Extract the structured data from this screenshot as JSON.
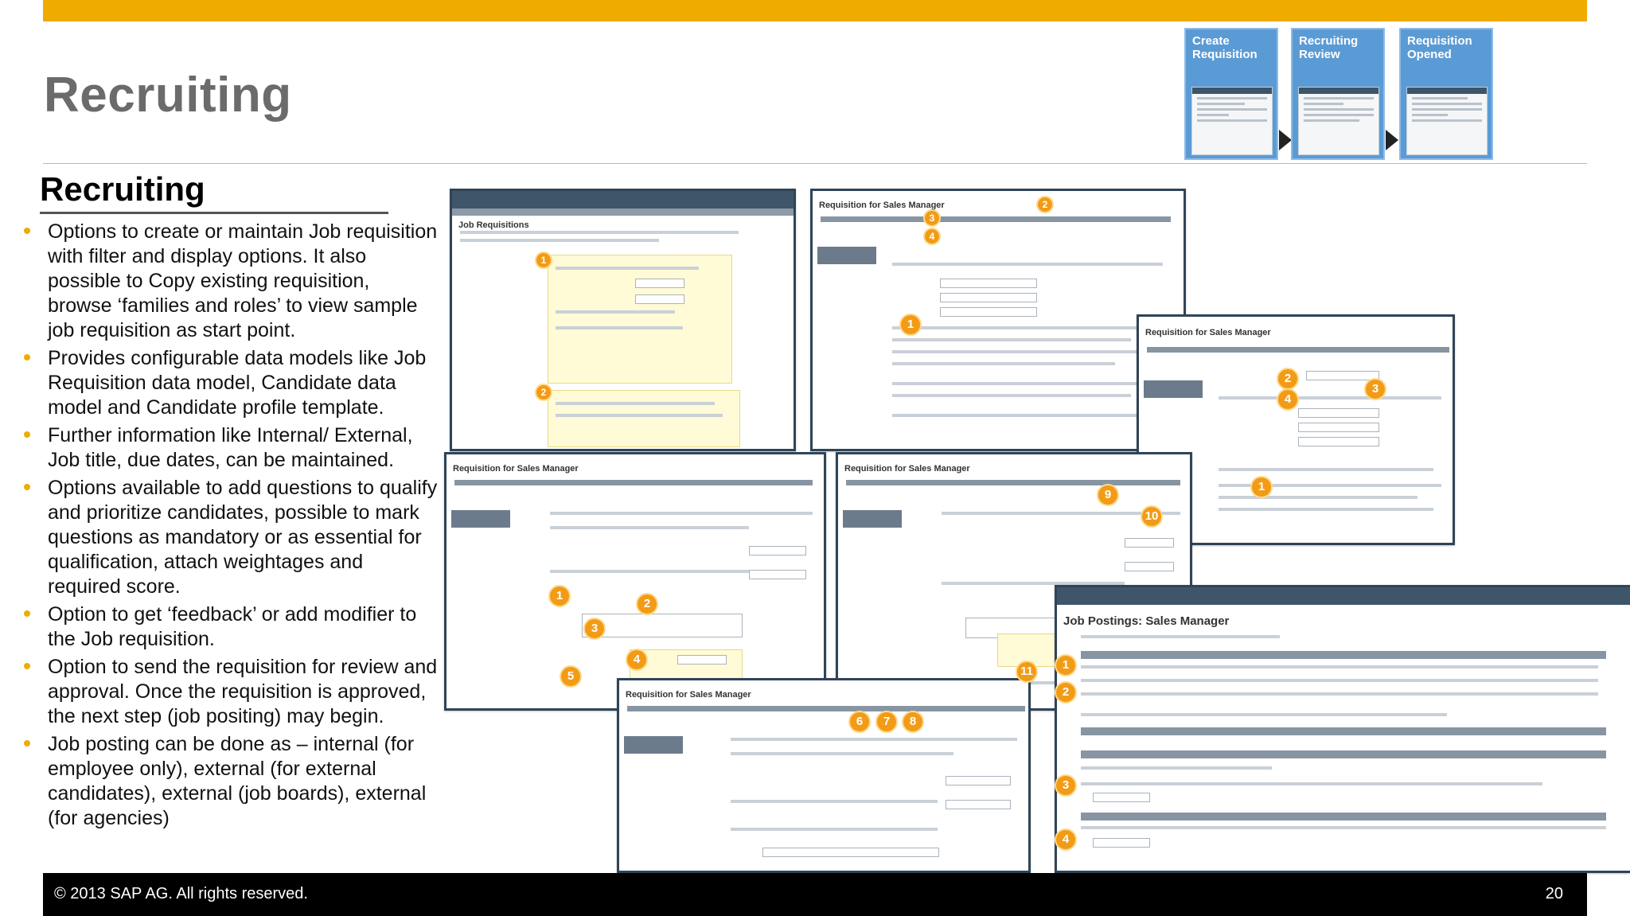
{
  "header": {
    "title": "Recruiting"
  },
  "process_steps": [
    {
      "label": "Create Requisition"
    },
    {
      "label": "Recruiting Review"
    },
    {
      "label": "Requisition Opened"
    }
  ],
  "content": {
    "heading": "Recruiting",
    "bullets": [
      "Options to create or maintain Job requisition with filter and display options. It also possible to Copy existing requisition, browse ‘families and roles’ to view sample job requisition as start point.",
      "Provides configurable data models like Job Requisition data model, Candidate data model and Candidate profile template.",
      "Further information like Internal/ External, Job title, due dates, can be maintained.",
      "Options available to add questions to qualify and prioritize candidates, possible to mark questions as mandatory or as essential for qualification, attach weightages and required score.",
      "Option to get ‘feedback’ or add modifier to the Job requisition.",
      "Option to send the requisition for review and approval. Once the requisition is approved, the next step (job positing) may begin.",
      "Job posting can be done as – internal (for employee only), external (for external candidates), external (job boards), external (for agencies)"
    ]
  },
  "screenshots": {
    "job_requisitions": {
      "title": "Job Requisitions"
    },
    "req_1": {
      "title": "Requisition for Sales Manager"
    },
    "req_2": {
      "title": "Requisition for Sales Manager"
    },
    "req_3": {
      "title": "Requisition for Sales Manager"
    },
    "req_4": {
      "title": "Requisition for Sales Manager"
    },
    "req_5": {
      "title": "Requisition for Sales Manager"
    },
    "job_postings": {
      "title": "Job Postings: Sales Manager"
    }
  },
  "badges": {
    "n1": "1",
    "n2": "2",
    "n3": "3",
    "n4": "4",
    "n5": "5",
    "n6": "6",
    "n7": "7",
    "n8": "8",
    "n9": "9",
    "n10": "10",
    "n11": "11"
  },
  "footer": {
    "copyright": "© 2013 SAP AG. All rights reserved.",
    "page_number": "20"
  },
  "colors": {
    "accent": "#f0ab00",
    "badge": "#f29b17",
    "step_blue": "#5b9bd5",
    "window_frame": "#2f4457"
  }
}
